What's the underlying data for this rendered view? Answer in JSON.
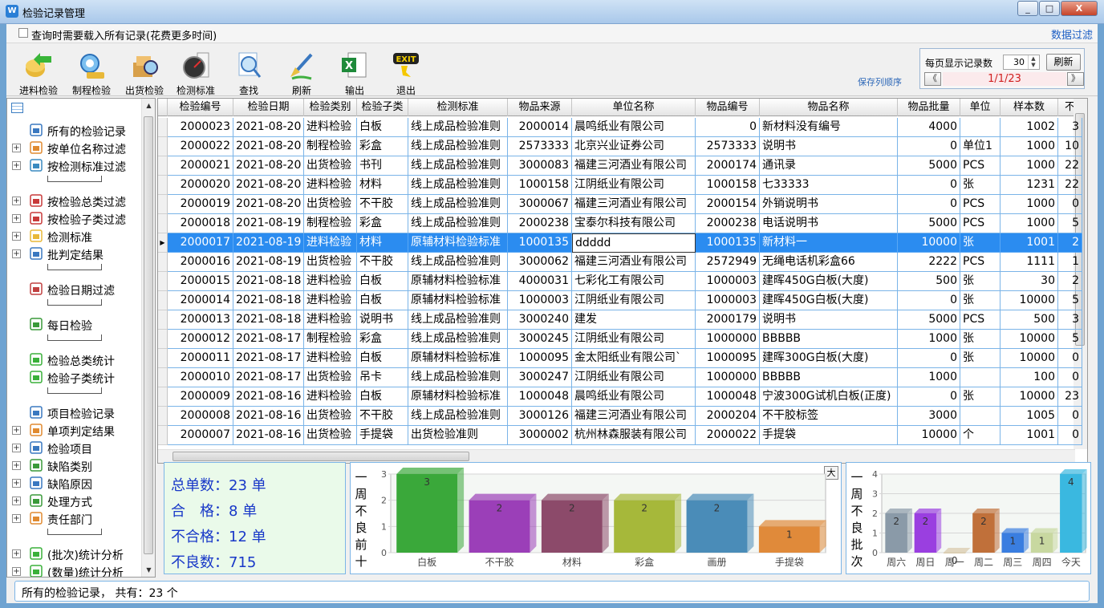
{
  "window": {
    "title": "检验记录管理",
    "controls": [
      "_",
      "□",
      "X"
    ]
  },
  "options": {
    "load_all_label": "查询时需要载入所有记录(花费更多时间)",
    "data_filter_link": "数据过滤"
  },
  "toolbar": {
    "buttons": [
      {
        "label": "进料检验",
        "icon": "incoming-inspection-icon"
      },
      {
        "label": "制程检验",
        "icon": "process-inspection-icon"
      },
      {
        "label": "出货检验",
        "icon": "shipping-inspection-icon"
      },
      {
        "label": "检测标准",
        "icon": "gauge-icon"
      },
      {
        "label": "查找",
        "icon": "search-icon"
      },
      {
        "label": "刷新",
        "icon": "brush-icon"
      },
      {
        "label": "输出",
        "icon": "excel-icon"
      },
      {
        "label": "退出",
        "icon": "exit-icon"
      }
    ],
    "save_columns_label": "保存列顺序",
    "exit_badge": "EXIT",
    "excel_badge": "X"
  },
  "pager": {
    "per_page_label": "每页显示记录数",
    "per_page_value": "30",
    "refresh_label": "刷新",
    "prev": "《",
    "next": "》",
    "page_text": "1/1/23",
    "spin_up": "▲",
    "spin_down": "▼"
  },
  "tree": {
    "items": [
      {
        "label": "所有的检验记录",
        "expander": ""
      },
      {
        "label": "按单位名称过滤",
        "expander": "+"
      },
      {
        "label": "按检测标准过滤",
        "expander": "+"
      },
      {
        "label": "按检验总类过滤",
        "expander": "+"
      },
      {
        "label": "按检验子类过滤",
        "expander": "+"
      },
      {
        "label": "检测标准",
        "expander": "+"
      },
      {
        "label": "批判定结果",
        "expander": "+"
      },
      {
        "label": "检验日期过滤",
        "expander": ""
      },
      {
        "label": "每日检验",
        "expander": ""
      },
      {
        "label": "检验总类统计",
        "expander": ""
      },
      {
        "label": "检验子类统计",
        "expander": ""
      },
      {
        "label": "项目检验记录",
        "expander": ""
      },
      {
        "label": "单项判定结果",
        "expander": "+"
      },
      {
        "label": "检验项目",
        "expander": "+"
      },
      {
        "label": "缺陷类别",
        "expander": "+"
      },
      {
        "label": "缺陷原因",
        "expander": "+"
      },
      {
        "label": "处理方式",
        "expander": "+"
      },
      {
        "label": "责任部门",
        "expander": "+"
      },
      {
        "label": "(批次)统计分析",
        "expander": "+"
      },
      {
        "label": "(数量)统计分析",
        "expander": "+"
      }
    ]
  },
  "table": {
    "columns": [
      "检验编号",
      "检验日期",
      "检验类别",
      "检验子类",
      "检测标准",
      "物品来源",
      "单位名称",
      "物品编号",
      "物品名称",
      "物品批量",
      "单位",
      "样本数",
      "不"
    ],
    "selected_row": 6,
    "rows": [
      [
        "2000023",
        "2021-08-20",
        "进料检验",
        "白板",
        "线上成品检验准则",
        "2000014",
        "晨鸣纸业有限公司",
        "0",
        "新材料没有编号",
        "4000",
        "",
        "1002",
        "3"
      ],
      [
        "2000022",
        "2021-08-20",
        "制程检验",
        "彩盒",
        "线上成品检验准则",
        "2573333",
        "北京兴业证券公司",
        "2573333",
        "说明书",
        "0",
        "单位1",
        "1000",
        "10"
      ],
      [
        "2000021",
        "2021-08-20",
        "出货检验",
        "书刊",
        "线上成品检验准则",
        "3000083",
        "福建三河酒业有限公司",
        "2000174",
        "通讯录",
        "5000",
        "PCS",
        "1000",
        "22"
      ],
      [
        "2000020",
        "2021-08-20",
        "进料检验",
        "材料",
        "线上成品检验准则",
        "1000158",
        "江阴纸业有限公司",
        "1000158",
        "七33333",
        "0",
        "张",
        "1231",
        "22"
      ],
      [
        "2000019",
        "2021-08-20",
        "出货检验",
        "不干胶",
        "线上成品检验准则",
        "3000067",
        "福建三河酒业有限公司",
        "2000154",
        "外销说明书",
        "0",
        "PCS",
        "1000",
        "0"
      ],
      [
        "2000018",
        "2021-08-19",
        "制程检验",
        "彩盒",
        "线上成品检验准则",
        "2000238",
        "宝泰尔科技有限公司",
        "2000238",
        "电话说明书",
        "5000",
        "PCS",
        "1000",
        "5"
      ],
      [
        "2000017",
        "2021-08-19",
        "进料检验",
        "材料",
        "原辅材料检验标准",
        "1000135",
        "ddddd",
        "1000135",
        "新材料一",
        "10000",
        "张",
        "1001",
        "2"
      ],
      [
        "2000016",
        "2021-08-19",
        "出货检验",
        "不干胶",
        "线上成品检验准则",
        "3000062",
        "福建三河酒业有限公司",
        "2572949",
        "无绳电话机彩盒66",
        "2222",
        "PCS",
        "1111",
        "1"
      ],
      [
        "2000015",
        "2021-08-18",
        "进料检验",
        "白板",
        "原辅材料检验标准",
        "4000031",
        "七彩化工有限公司",
        "1000003",
        "建晖450G白板(大度)",
        "500",
        "张",
        "30",
        "2"
      ],
      [
        "2000014",
        "2021-08-18",
        "进料检验",
        "白板",
        "原辅材料检验标准",
        "1000003",
        "江阴纸业有限公司",
        "1000003",
        "建晖450G白板(大度)",
        "0",
        "张",
        "10000",
        "5"
      ],
      [
        "2000013",
        "2021-08-18",
        "进料检验",
        "说明书",
        "线上成品检验准则",
        "3000240",
        "建发",
        "2000179",
        "说明书",
        "5000",
        "PCS",
        "500",
        "3"
      ],
      [
        "2000012",
        "2021-08-17",
        "制程检验",
        "彩盒",
        "线上成品检验准则",
        "3000245",
        "江阴纸业有限公司",
        "1000000",
        "BBBBB",
        "1000",
        "张",
        "10000",
        "5"
      ],
      [
        "2000011",
        "2021-08-17",
        "进料检验",
        "白板",
        "原辅材料检验标准",
        "1000095",
        "金太阳纸业有限公司`",
        "1000095",
        "建晖300G白板(大度)",
        "0",
        "张",
        "10000",
        "0"
      ],
      [
        "2000010",
        "2021-08-17",
        "出货检验",
        "吊卡",
        "线上成品检验准则",
        "3000247",
        "江阴纸业有限公司",
        "1000000",
        "BBBBB",
        "1000",
        "",
        "100",
        "0"
      ],
      [
        "2000009",
        "2021-08-16",
        "进料检验",
        "白板",
        "原辅材料检验标准",
        "1000048",
        "晨鸣纸业有限公司",
        "1000048",
        "宁波300G试机白板(正度)",
        "0",
        "张",
        "10000",
        "23"
      ],
      [
        "2000008",
        "2021-08-16",
        "出货检验",
        "不干胶",
        "线上成品检验准则",
        "3000126",
        "福建三河酒业有限公司",
        "2000204",
        "不干胶标签",
        "3000",
        "",
        "1005",
        "0"
      ],
      [
        "2000007",
        "2021-08-16",
        "出货检验",
        "手提袋",
        "出货检验准则",
        "3000002",
        "杭州林森服装有限公司",
        "2000022",
        "手提袋",
        "10000",
        "个",
        "1001",
        "0"
      ]
    ]
  },
  "stats": {
    "total_label": "总单数：",
    "total_value": "23",
    "total_unit": "单",
    "pass_label": "合　格：",
    "pass_value": "8",
    "pass_unit": "单",
    "fail_label": "不合格：",
    "fail_value": "12",
    "fail_unit": "单",
    "defect_label": "不良数：",
    "defect_value": "715"
  },
  "chart_data": [
    {
      "type": "bar",
      "title": "一周不良前十",
      "categories": [
        "白板",
        "不干胶",
        "材料",
        "彩盒",
        "画册",
        "手提袋"
      ],
      "values": [
        3,
        2,
        2,
        2,
        2,
        1
      ],
      "ylim": [
        0,
        3
      ],
      "yticks": [
        "0",
        "1",
        "2",
        "3"
      ],
      "colors": [
        "#3aa83a",
        "#9b3fb8",
        "#8c4a6a",
        "#a6b83a",
        "#4a8cb8",
        "#e08a3a"
      ],
      "button_label": "大",
      "grid": true
    },
    {
      "type": "bar",
      "title": "一周不良批次",
      "categories": [
        "周六",
        "周日",
        "周一",
        "周二",
        "周三",
        "周四",
        "今天"
      ],
      "values": [
        2,
        2,
        0,
        2,
        1,
        1,
        4
      ],
      "ylim": [
        0,
        4
      ],
      "yticks": [
        "0",
        "1",
        "2",
        "3",
        "4"
      ],
      "colors": [
        "#8a9aa8",
        "#9a3fe0",
        "#d8c8a8",
        "#c0703a",
        "#3a7ee0",
        "#c8d8a0",
        "#3ab8e0"
      ],
      "grid": true
    }
  ],
  "status": {
    "text": "所有的检验记录，  共有：23  个"
  }
}
